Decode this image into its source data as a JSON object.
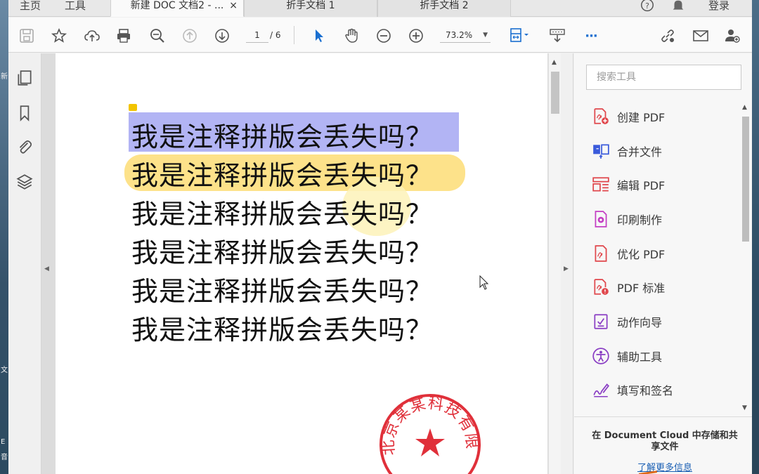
{
  "window": {
    "nav": {
      "home": "主页",
      "tools": "工具"
    },
    "tabs": [
      {
        "label": "新建 DOC 文档2 - ...",
        "active": true
      },
      {
        "label": "折手文档 1",
        "active": false
      },
      {
        "label": "折手文档 2",
        "active": false
      }
    ],
    "tab_close": "×",
    "signin": "登录"
  },
  "toolbar": {
    "page_current": "1",
    "page_total": "/ 6",
    "zoom": "73.2%",
    "more": "···"
  },
  "document": {
    "lines": [
      "我是注释拼版会丢失吗？",
      "我是注释拼版会丢失吗？",
      "我是注释拼版会丢失吗？",
      "我是注释拼版会丢失吗？",
      "我是注释拼版会丢失吗？",
      "我是注释拼版会丢失吗？"
    ],
    "stamp_text": "北京某某科技有限公司",
    "colors": {
      "blue_highlight": "#b2b4f4",
      "yellow_highlight": "#fde28a",
      "stamp_red": "#e0303a"
    }
  },
  "right_panel": {
    "search_placeholder": "搜索工具",
    "tools": [
      {
        "label": "创建 PDF",
        "icon": "create-pdf-icon",
        "color": "#e0474c"
      },
      {
        "label": "合并文件",
        "icon": "combine-files-icon",
        "color": "#3b5bdb"
      },
      {
        "label": "编辑 PDF",
        "icon": "edit-pdf-icon",
        "color": "#e0474c"
      },
      {
        "label": "印刷制作",
        "icon": "print-production-icon",
        "color": "#c43ec4"
      },
      {
        "label": "优化 PDF",
        "icon": "optimize-pdf-icon",
        "color": "#e0474c"
      },
      {
        "label": "PDF 标准",
        "icon": "pdf-standards-icon",
        "color": "#e0474c"
      },
      {
        "label": "动作向导",
        "icon": "action-wizard-icon",
        "color": "#8a3ec4"
      },
      {
        "label": "辅助工具",
        "icon": "accessibility-icon",
        "color": "#8a3ec4"
      },
      {
        "label": "填写和签名",
        "icon": "fill-sign-icon",
        "color": "#8a3ec4"
      }
    ],
    "cloud_text": "在 Document Cloud 中存储和共享文件",
    "learn_more": "了解更多信息"
  },
  "desktop": {
    "glyphs": [
      "新",
      "文",
      "E",
      "音"
    ]
  }
}
